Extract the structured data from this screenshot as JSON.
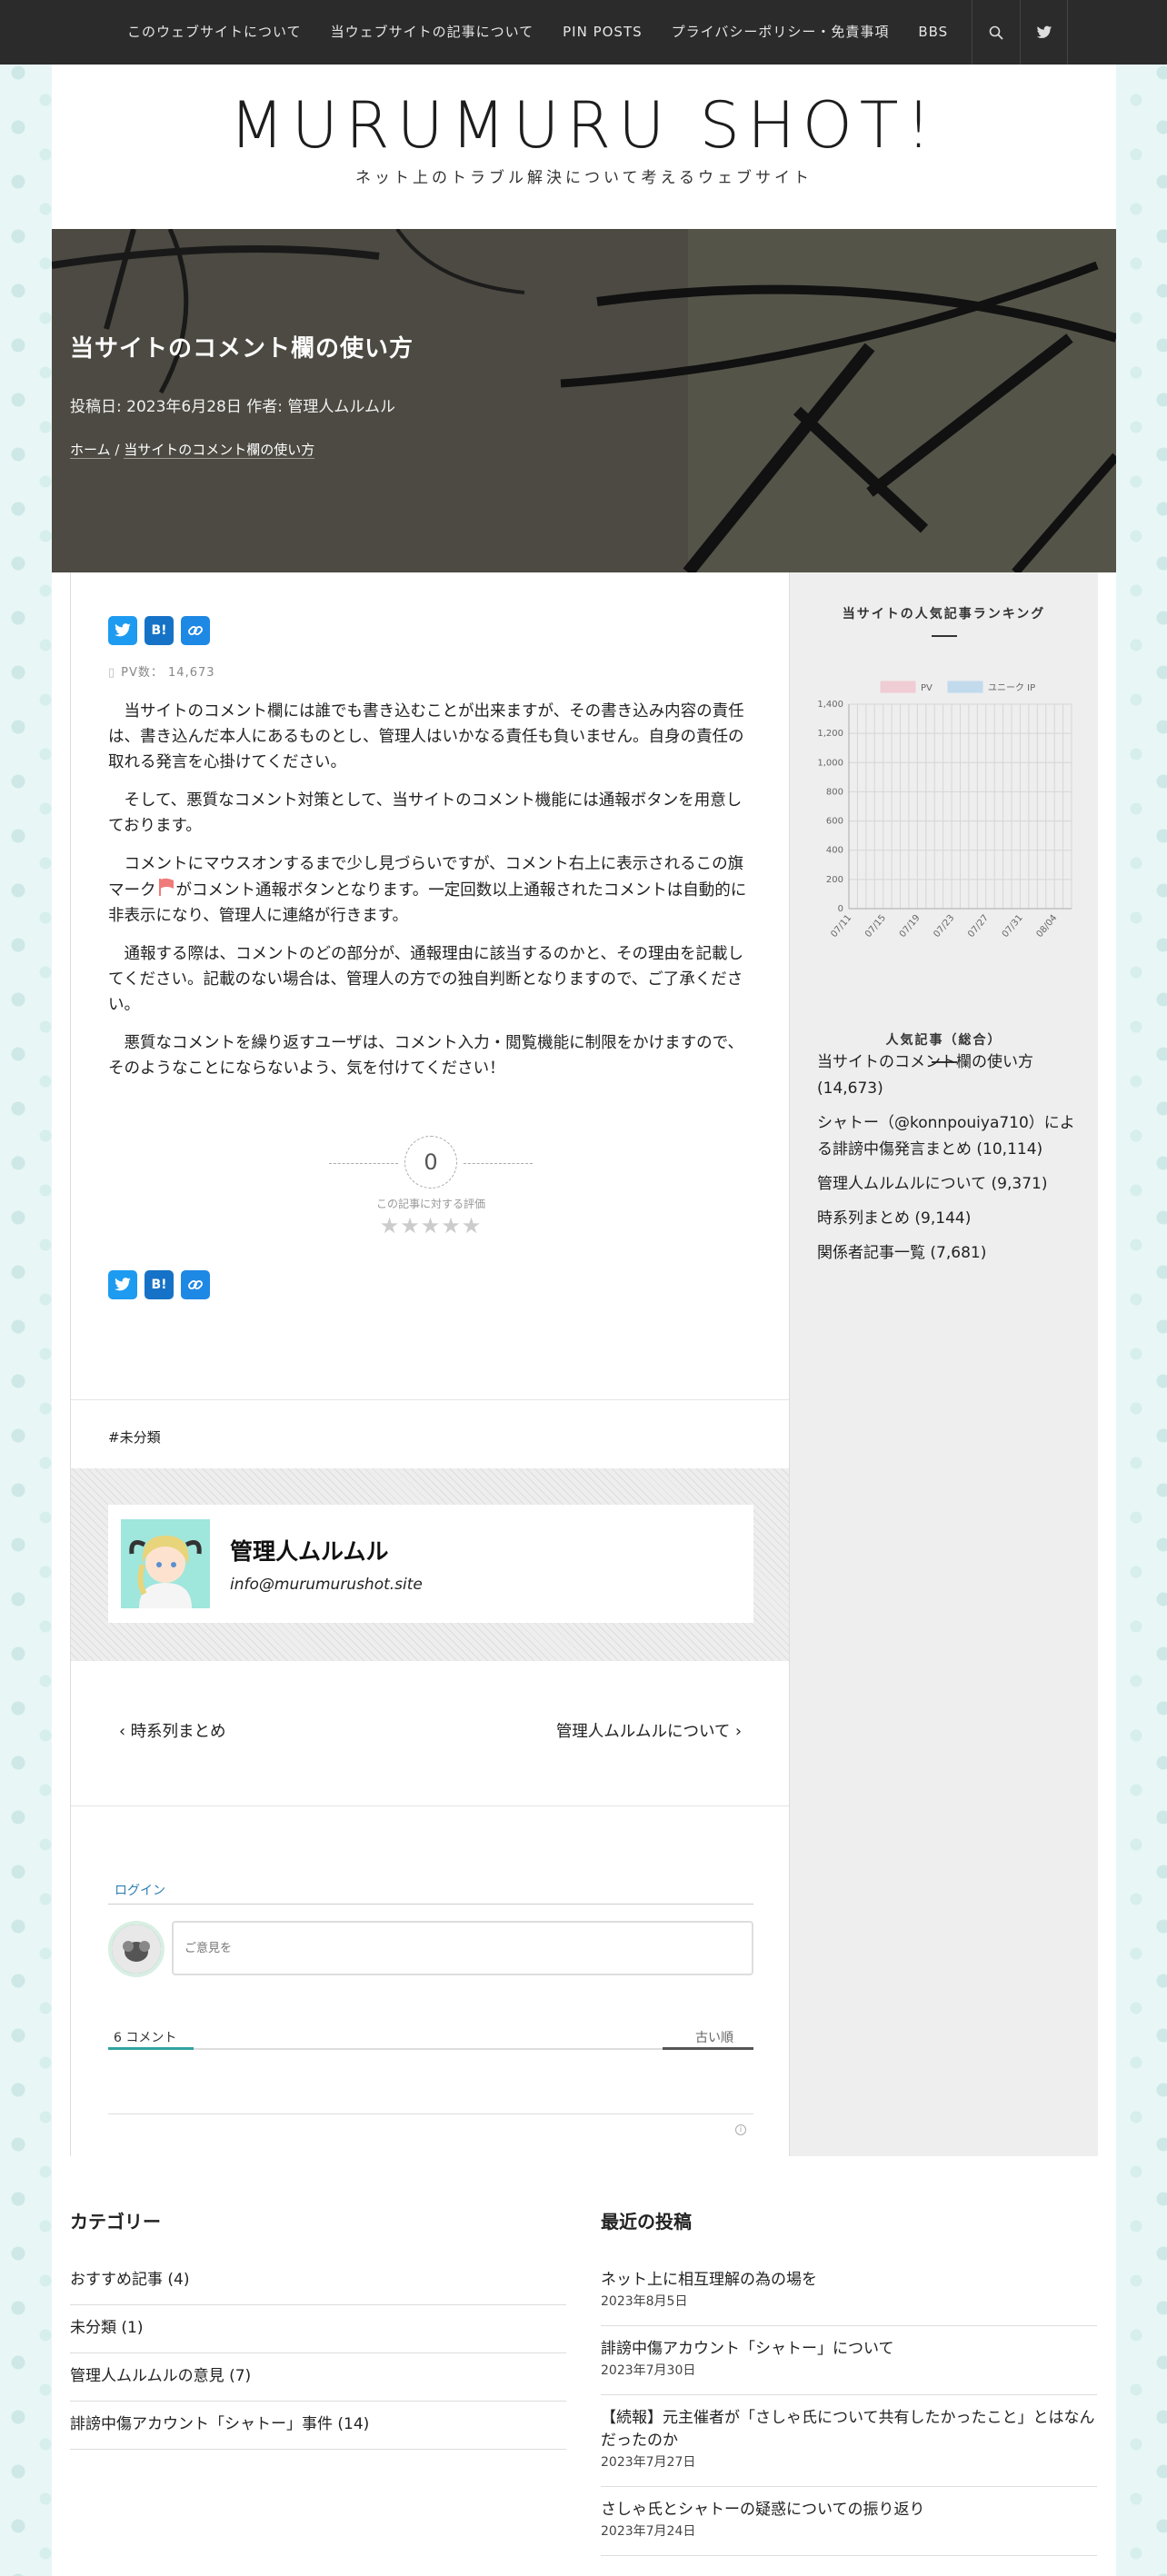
{
  "nav": {
    "items": [
      "このウェブサイトについて",
      "当ウェブサイトの記事について",
      "PIN POSTS",
      "プライバシーポリシー・免責事項",
      "BBS"
    ],
    "search_icon": "search-icon",
    "twitter_icon": "twitter-icon"
  },
  "site": {
    "title": "MURUMURU SHOT!",
    "description": "ネット上のトラブル解決について考えるウェブサイト"
  },
  "post": {
    "title": "当サイトのコメント欄の使い方",
    "meta": "投稿日: 2023年6月28日  作者: 管理人ムルムル",
    "breadcrumb_home": "ホーム",
    "breadcrumb_sep": "/",
    "breadcrumb_current": "当サイトのコメント欄の使い方",
    "pv": "PV数： 14,673",
    "paragraphs": [
      "当サイトのコメント欄には誰でも書き込むことが出来ますが、その書き込み内容の責任は、書き込んだ本人にあるものとし、管理人はいかなる責任も負いません。自身の責任の取れる発言を心掛けてください。",
      "そして、悪質なコメント対策として、当サイトのコメント機能には通報ボタンを用意しております。",
      "コメントにマウスオンするまで少し見づらいですが、コメント右上に表示されるこの旗マーク",
      "がコメント通報ボタンとなります。一定回数以上通報されたコメントは自動的に非表示になり、管理人に連絡が行きます。",
      "通報する際は、コメントのどの部分が、通報理由に該当するのかと、その理由を記載してください。記載のない場合は、管理人の方での独自判断となりますので、ご了承ください。",
      "悪質なコメントを繰り返すユーザは、コメント入力・閲覧機能に制限をかけますので、そのようなことにならないよう、気を付けてください！"
    ],
    "rating_value": "0",
    "rating_label": "この記事に対する評価",
    "stars": "★★★★★",
    "tag": "#未分類",
    "share": {
      "twitter": "twitter-icon",
      "hatena": "B!",
      "link": "link-icon"
    }
  },
  "author": {
    "name": "管理人ムルムル",
    "email": "info@murumurushot.site"
  },
  "postnav": {
    "prev": "時系列まとめ",
    "next": "管理人ムルムルについて"
  },
  "comments": {
    "login": "ログイン",
    "placeholder": "ご意見を",
    "count": "6 コメント",
    "sort": "古い順"
  },
  "sidebar": {
    "chart_title": "当サイトの人気記事ランキング",
    "popular_title": "人気記事（総合）",
    "popular": [
      "当サイトのコメント欄の使い方 (14,673)",
      "シャトー（@konnpouiya710）による誹謗中傷発言まとめ (10,114)",
      "管理人ムルムルについて (9,371)",
      "時系列まとめ (9,144)",
      "関係者記事一覧 (7,681)"
    ]
  },
  "footer": {
    "categories_title": "カテゴリー",
    "categories": [
      "おすすめ記事 (4)",
      "未分類 (1)",
      "管理人ムルムルの意見 (7)",
      "誹謗中傷アカウント「シャトー」事件 (14)"
    ],
    "recent_title": "最近の投稿",
    "recent": [
      {
        "title": "ネット上に相互理解の為の場を",
        "date": "2023年8月5日"
      },
      {
        "title": "誹謗中傷アカウント「シャトー」について",
        "date": "2023年7月30日"
      },
      {
        "title": "【続報】元主催者が「さしゃ氏について共有したかったこと」とはなんだったのか",
        "date": "2023年7月27日"
      },
      {
        "title": "さしゃ氏とシャトーの疑惑についての振り返り",
        "date": "2023年7月24日"
      }
    ]
  },
  "chart_data": {
    "type": "line",
    "series": [
      {
        "name": "PV",
        "color": "#f4a3b5",
        "values": []
      },
      {
        "name": "ユニーク IP",
        "color": "#8cc3ea",
        "values": []
      }
    ],
    "x_ticks": [
      "07/11",
      "07/15",
      "07/19",
      "07/23",
      "07/27",
      "07/31",
      "08/04"
    ],
    "y_ticks": [
      "0",
      "200",
      "400",
      "600",
      "800",
      "1,000",
      "1,200",
      "1,400"
    ],
    "ylim": [
      0,
      1400
    ],
    "grid": true,
    "legend": "top"
  }
}
